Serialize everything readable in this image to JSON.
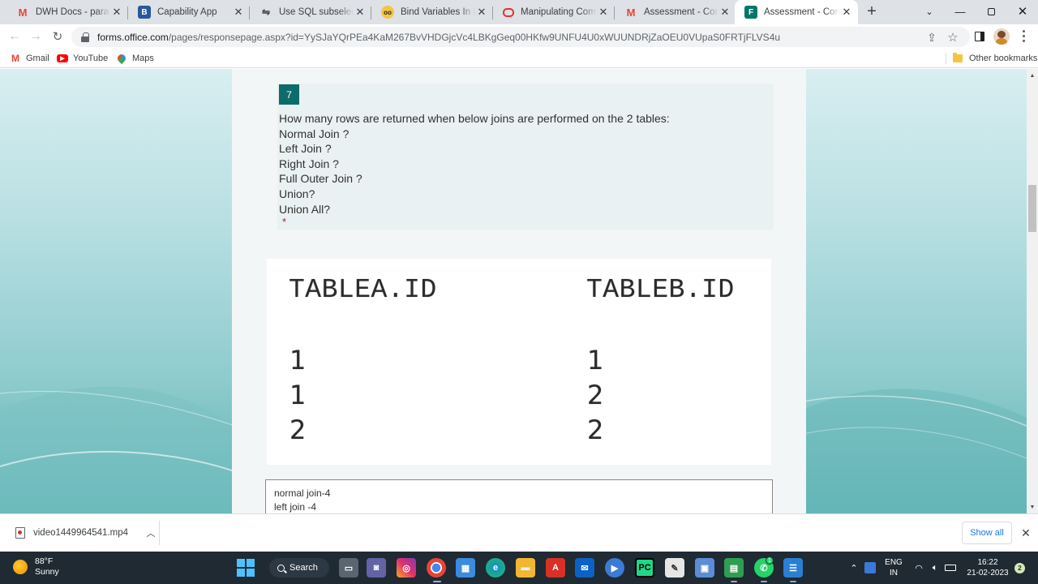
{
  "browser": {
    "tabs": [
      {
        "title": "DWH Docs - paradhan",
        "favicon": "gmail-icon",
        "active": false
      },
      {
        "title": "Capability App",
        "favicon": "app-icon",
        "active": false
      },
      {
        "title": "Use SQL subselects to",
        "favicon": "sql-icon",
        "active": false
      },
      {
        "title": "Bind Variables In PL/SQL",
        "favicon": "glasses-icon",
        "active": false
      },
      {
        "title": "Manipulating Comma",
        "favicon": "oracle-icon",
        "active": false
      },
      {
        "title": "Assessment - Concern",
        "favicon": "gmail-icon",
        "active": false
      },
      {
        "title": "Assessment - Concern",
        "favicon": "forms-icon",
        "active": true
      }
    ],
    "url_host": "forms.office.com",
    "url_path": "/pages/responsepage.aspx?id=YySJaYQrPEa4KaM267BvVHDGjcVc4LBKgGeq00HKfw9UNFU4U0xWUUNDRjZaOEU0VUpaS0FRTjFLVS4u",
    "bookmarks": [
      {
        "label": "Gmail",
        "icon": "gmail-icon"
      },
      {
        "label": "YouTube",
        "icon": "youtube-icon"
      },
      {
        "label": "Maps",
        "icon": "maps-pin-icon"
      }
    ],
    "other_bookmarks": "Other bookmarks"
  },
  "question": {
    "number": "7",
    "lines": [
      "How many rows are returned when below joins are performed on the 2 tables:",
      "Normal Join ?",
      "Left Join ?",
      "Right Join ?",
      "Full Outer Join ?",
      "Union?",
      "Union All?"
    ],
    "required_mark": "*",
    "image": {
      "col_a_header": "TABLEA.ID",
      "col_b_header": "TABLEB.ID",
      "col_a": [
        "1",
        "1",
        "2"
      ],
      "col_b": [
        "1",
        "2",
        "2"
      ]
    },
    "answer_lines": [
      "normal join-4",
      "left join -4"
    ]
  },
  "downloads": {
    "filename": "video1449964541.mp4",
    "show_all": "Show all"
  },
  "taskbar": {
    "temperature": "88°F",
    "condition": "Sunny",
    "search_label": "Search",
    "lang_line1": "ENG",
    "lang_line2": "IN",
    "time": "16:22",
    "date": "21-02-2023",
    "notification_count": "2",
    "whatsapp_badge": "1"
  },
  "colors": {
    "accent": "#0e6b6b",
    "required": "#a4262c",
    "link": "#1a73e8",
    "taskbar": "#1f2a33"
  }
}
